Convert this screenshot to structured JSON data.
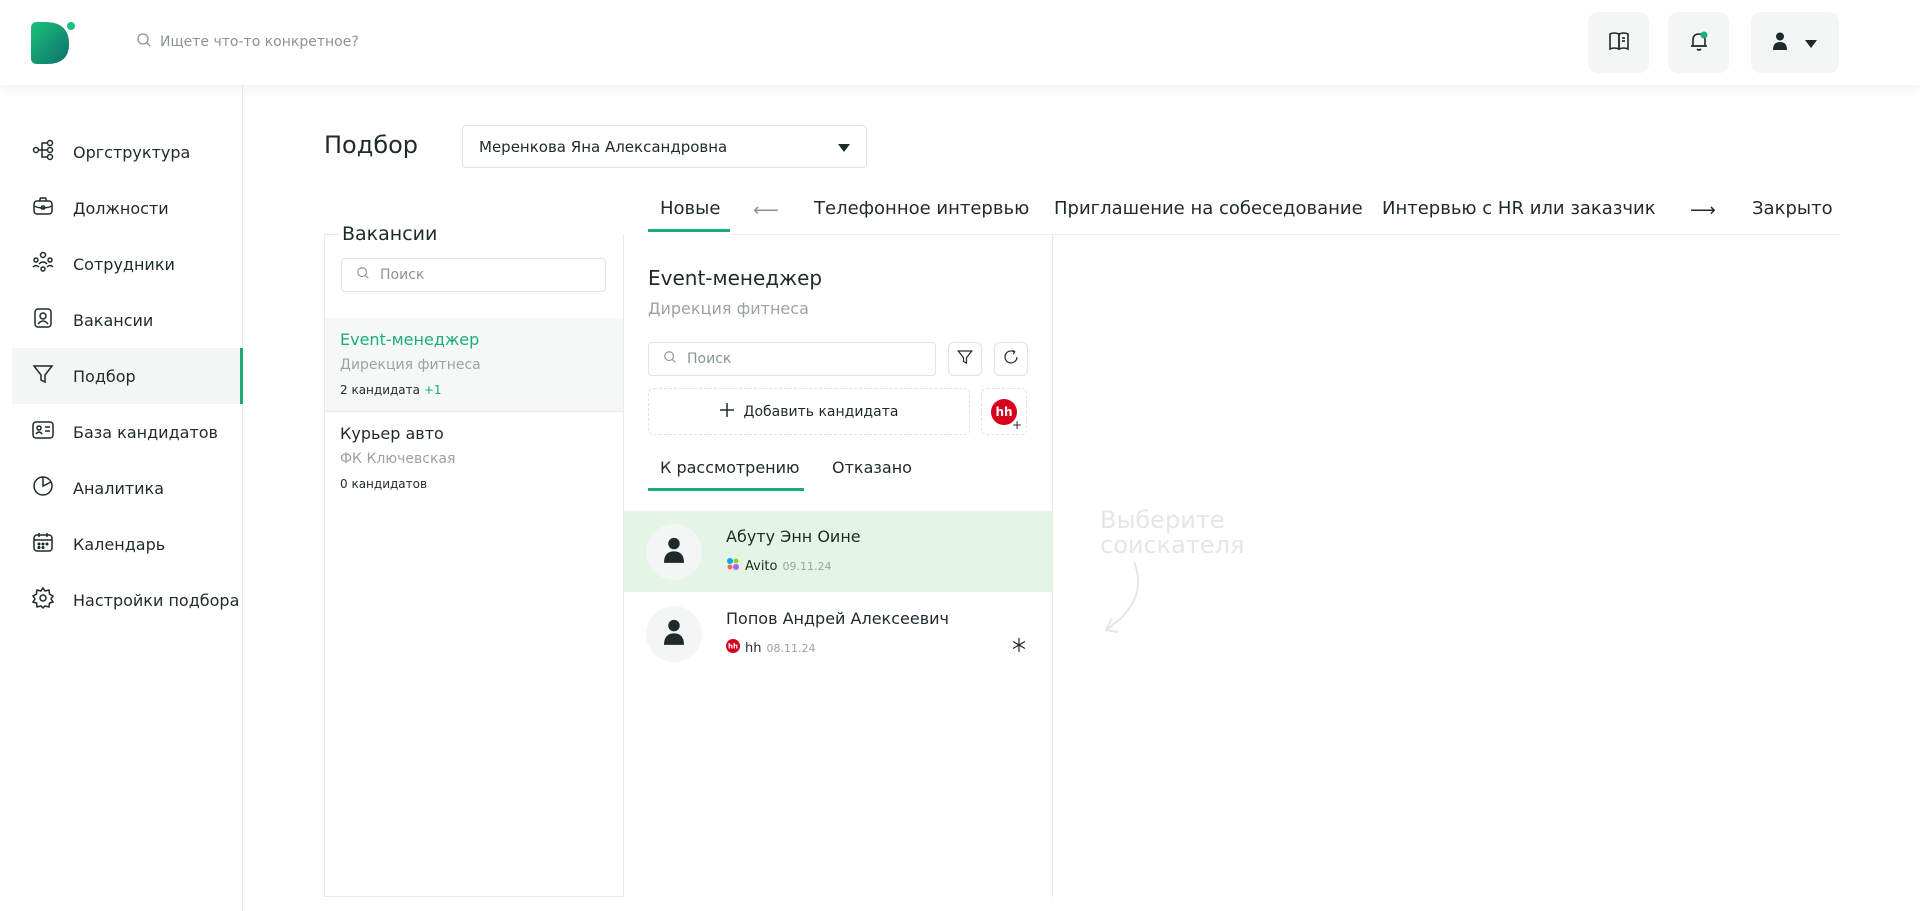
{
  "header": {
    "search_placeholder": "Ищете что-то конкретное?"
  },
  "sidebar": {
    "items": [
      {
        "label": "Оргструктура",
        "icon": "org-structure-icon"
      },
      {
        "label": "Должности",
        "icon": "briefcase-icon"
      },
      {
        "label": "Сотрудники",
        "icon": "employees-icon"
      },
      {
        "label": "Вакансии",
        "icon": "vacancy-icon"
      },
      {
        "label": "Подбор",
        "icon": "funnel-icon",
        "active": true
      },
      {
        "label": "База кандидатов",
        "icon": "contact-card-icon"
      },
      {
        "label": "Аналитика",
        "icon": "pie-chart-icon"
      },
      {
        "label": "Календарь",
        "icon": "calendar-icon"
      },
      {
        "label": "Настройки подбора",
        "icon": "gear-icon"
      }
    ]
  },
  "main": {
    "title": "Подбор",
    "recruiter": "Меренкова Яна Александровна",
    "stages": [
      "Новые",
      "Телефонное интервью",
      "Приглашение на собеседование",
      "Интервью с HR или заказчик",
      "Закрыто"
    ],
    "active_stage": "Новые"
  },
  "vacancies": {
    "title": "Вакансии",
    "search_placeholder": "Поиск",
    "items": [
      {
        "name": "Event-менеджер",
        "department": "Дирекция фитнеса",
        "count": "2 кандидата",
        "new": "+1",
        "active": true
      },
      {
        "name": "Курьер авто",
        "department": "ФК Ключевская",
        "count": "0 кандидатов",
        "new": ""
      }
    ]
  },
  "candidates_panel": {
    "title": "Event-менеджер",
    "department": "Дирекция фитнеса",
    "search_placeholder": "Поиск",
    "add_label": "Добавить кандидата",
    "hh_label": "hh",
    "tabs": [
      "К рассмотрению",
      "Отказано"
    ],
    "candidates": [
      {
        "name": "Абуту Энн Оине",
        "source": "Avito",
        "date": "09.11.24",
        "active": true
      },
      {
        "name": "Попов Андрей Алексеевич",
        "source": "hh",
        "date": "08.11.24"
      }
    ]
  },
  "detail": {
    "empty_hint_line1": "Выберите",
    "empty_hint_line2": "соискателя"
  },
  "colors": {
    "accent": "#1bad74",
    "active_row": "#e3f6e5",
    "hh_red": "#d6001c"
  }
}
